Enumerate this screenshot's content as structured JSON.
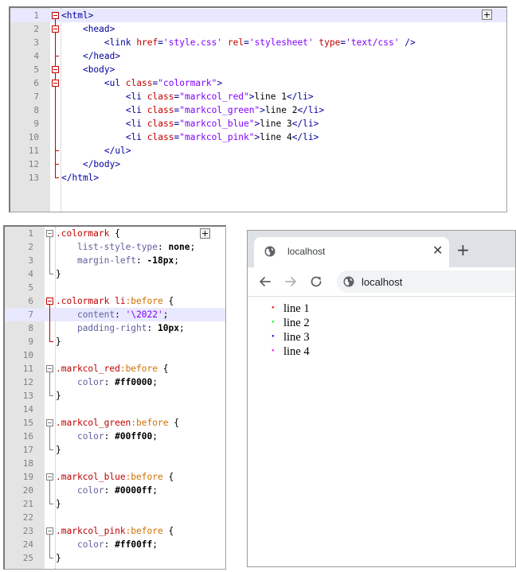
{
  "html_editor": {
    "lines": [
      {
        "n": "1",
        "tokens": [
          [
            "tag",
            "<html>"
          ]
        ]
      },
      {
        "n": "2",
        "tokens": [
          [
            "txt",
            "    "
          ],
          [
            "tag",
            "<head>"
          ]
        ]
      },
      {
        "n": "3",
        "tokens": [
          [
            "txt",
            "        "
          ],
          [
            "tag",
            "<link "
          ],
          [
            "attr",
            "href"
          ],
          [
            "tag",
            "="
          ],
          [
            "str",
            "'style.css'"
          ],
          [
            "txt",
            " "
          ],
          [
            "attr",
            "rel"
          ],
          [
            "tag",
            "="
          ],
          [
            "str",
            "'stylesheet'"
          ],
          [
            "txt",
            " "
          ],
          [
            "attr",
            "type"
          ],
          [
            "tag",
            "="
          ],
          [
            "str",
            "'text/css'"
          ],
          [
            "tag",
            " />"
          ]
        ]
      },
      {
        "n": "4",
        "tokens": [
          [
            "txt",
            "    "
          ],
          [
            "tag",
            "</head>"
          ]
        ]
      },
      {
        "n": "5",
        "tokens": [
          [
            "txt",
            "    "
          ],
          [
            "tag",
            "<body>"
          ]
        ]
      },
      {
        "n": "6",
        "tokens": [
          [
            "txt",
            "        "
          ],
          [
            "tag",
            "<ul "
          ],
          [
            "attr",
            "class"
          ],
          [
            "tag",
            "="
          ],
          [
            "str",
            "\"colormark\""
          ],
          [
            "tag",
            ">"
          ]
        ]
      },
      {
        "n": "7",
        "tokens": [
          [
            "txt",
            "            "
          ],
          [
            "tag",
            "<li "
          ],
          [
            "attr",
            "class"
          ],
          [
            "tag",
            "="
          ],
          [
            "str",
            "\"markcol_red\""
          ],
          [
            "tag",
            ">"
          ],
          [
            "txt",
            "line 1"
          ],
          [
            "tag",
            "</li>"
          ]
        ]
      },
      {
        "n": "8",
        "tokens": [
          [
            "txt",
            "            "
          ],
          [
            "tag",
            "<li "
          ],
          [
            "attr",
            "class"
          ],
          [
            "tag",
            "="
          ],
          [
            "str",
            "\"markcol_green\""
          ],
          [
            "tag",
            ">"
          ],
          [
            "txt",
            "line 2"
          ],
          [
            "tag",
            "</li>"
          ]
        ]
      },
      {
        "n": "9",
        "tokens": [
          [
            "txt",
            "            "
          ],
          [
            "tag",
            "<li "
          ],
          [
            "attr",
            "class"
          ],
          [
            "tag",
            "="
          ],
          [
            "str",
            "\"markcol_blue\""
          ],
          [
            "tag",
            ">"
          ],
          [
            "txt",
            "line 3"
          ],
          [
            "tag",
            "</li>"
          ]
        ]
      },
      {
        "n": "10",
        "tokens": [
          [
            "txt",
            "            "
          ],
          [
            "tag",
            "<li "
          ],
          [
            "attr",
            "class"
          ],
          [
            "tag",
            "="
          ],
          [
            "str",
            "\"markcol_pink\""
          ],
          [
            "tag",
            ">"
          ],
          [
            "txt",
            "line 4"
          ],
          [
            "tag",
            "</li>"
          ]
        ]
      },
      {
        "n": "11",
        "tokens": [
          [
            "txt",
            "        "
          ],
          [
            "tag",
            "</ul>"
          ]
        ]
      },
      {
        "n": "12",
        "tokens": [
          [
            "txt",
            "    "
          ],
          [
            "tag",
            "</body>"
          ]
        ]
      },
      {
        "n": "13",
        "tokens": [
          [
            "tag",
            "</html>"
          ]
        ]
      }
    ],
    "highlight_line": 1,
    "fold_button": "+"
  },
  "css_editor": {
    "lines": [
      {
        "n": "1",
        "tokens": [
          [
            "sel",
            ".colormark"
          ],
          [
            "punc",
            " {"
          ]
        ]
      },
      {
        "n": "2",
        "tokens": [
          [
            "txt",
            "    "
          ],
          [
            "prop",
            "list-style-type"
          ],
          [
            "punc",
            ": "
          ],
          [
            "val",
            "none"
          ],
          [
            "punc",
            ";"
          ]
        ]
      },
      {
        "n": "3",
        "tokens": [
          [
            "txt",
            "    "
          ],
          [
            "prop",
            "margin-left"
          ],
          [
            "punc",
            ": "
          ],
          [
            "val",
            "-18px"
          ],
          [
            "punc",
            ";"
          ]
        ]
      },
      {
        "n": "4",
        "tokens": [
          [
            "punc",
            "}"
          ]
        ]
      },
      {
        "n": "5",
        "tokens": []
      },
      {
        "n": "6",
        "tokens": [
          [
            "sel",
            ".colormark li"
          ],
          [
            "pseudo",
            ":before"
          ],
          [
            "punc",
            " {"
          ]
        ]
      },
      {
        "n": "7",
        "tokens": [
          [
            "txt",
            "    "
          ],
          [
            "prop",
            "content"
          ],
          [
            "punc",
            ": "
          ],
          [
            "valstr",
            "'\\2022'"
          ],
          [
            "punc",
            ";"
          ]
        ]
      },
      {
        "n": "8",
        "tokens": [
          [
            "txt",
            "    "
          ],
          [
            "prop",
            "padding-right"
          ],
          [
            "punc",
            ": "
          ],
          [
            "val",
            "10px"
          ],
          [
            "punc",
            ";"
          ]
        ]
      },
      {
        "n": "9",
        "tokens": [
          [
            "punc",
            "}"
          ]
        ]
      },
      {
        "n": "10",
        "tokens": []
      },
      {
        "n": "11",
        "tokens": [
          [
            "sel",
            ".markcol_red"
          ],
          [
            "pseudo",
            ":before"
          ],
          [
            "punc",
            " {"
          ]
        ]
      },
      {
        "n": "12",
        "tokens": [
          [
            "txt",
            "    "
          ],
          [
            "prop",
            "color"
          ],
          [
            "punc",
            ": "
          ],
          [
            "val",
            "#ff0000"
          ],
          [
            "punc",
            ";"
          ]
        ]
      },
      {
        "n": "13",
        "tokens": [
          [
            "punc",
            "}"
          ]
        ]
      },
      {
        "n": "14",
        "tokens": []
      },
      {
        "n": "15",
        "tokens": [
          [
            "sel",
            ".markcol_green"
          ],
          [
            "pseudo",
            ":before"
          ],
          [
            "punc",
            " {"
          ]
        ]
      },
      {
        "n": "16",
        "tokens": [
          [
            "txt",
            "    "
          ],
          [
            "prop",
            "color"
          ],
          [
            "punc",
            ": "
          ],
          [
            "val",
            "#00ff00"
          ],
          [
            "punc",
            ";"
          ]
        ]
      },
      {
        "n": "17",
        "tokens": [
          [
            "punc",
            "}"
          ]
        ]
      },
      {
        "n": "18",
        "tokens": []
      },
      {
        "n": "19",
        "tokens": [
          [
            "sel",
            ".markcol_blue"
          ],
          [
            "pseudo",
            ":before"
          ],
          [
            "punc",
            " {"
          ]
        ]
      },
      {
        "n": "20",
        "tokens": [
          [
            "txt",
            "    "
          ],
          [
            "prop",
            "color"
          ],
          [
            "punc",
            ": "
          ],
          [
            "val",
            "#0000ff"
          ],
          [
            "punc",
            ";"
          ]
        ]
      },
      {
        "n": "21",
        "tokens": [
          [
            "punc",
            "}"
          ]
        ]
      },
      {
        "n": "22",
        "tokens": []
      },
      {
        "n": "23",
        "tokens": [
          [
            "sel",
            ".markcol_pink"
          ],
          [
            "pseudo",
            ":before"
          ],
          [
            "punc",
            " {"
          ]
        ]
      },
      {
        "n": "24",
        "tokens": [
          [
            "txt",
            "    "
          ],
          [
            "prop",
            "color"
          ],
          [
            "punc",
            ": "
          ],
          [
            "val",
            "#ff00ff"
          ],
          [
            "punc",
            ";"
          ]
        ]
      },
      {
        "n": "25",
        "tokens": [
          [
            "punc",
            "}"
          ]
        ]
      }
    ],
    "highlight_line": 7,
    "fold_button": "+"
  },
  "browser": {
    "tab_title": "localhost",
    "tab_close": "✕",
    "new_tab": "+",
    "address": "localhost",
    "favicon_icon": "globe-icon",
    "nav_icons": [
      "back-arrow-icon",
      "forward-arrow-icon",
      "reload-icon"
    ],
    "list": [
      {
        "text": "line 1",
        "bullet": "•",
        "color": "#ff0000"
      },
      {
        "text": "line 2",
        "bullet": "•",
        "color": "#00ff00"
      },
      {
        "text": "line 3",
        "bullet": "•",
        "color": "#0000ff"
      },
      {
        "text": "line 4",
        "bullet": "•",
        "color": "#ff00ff"
      }
    ]
  }
}
